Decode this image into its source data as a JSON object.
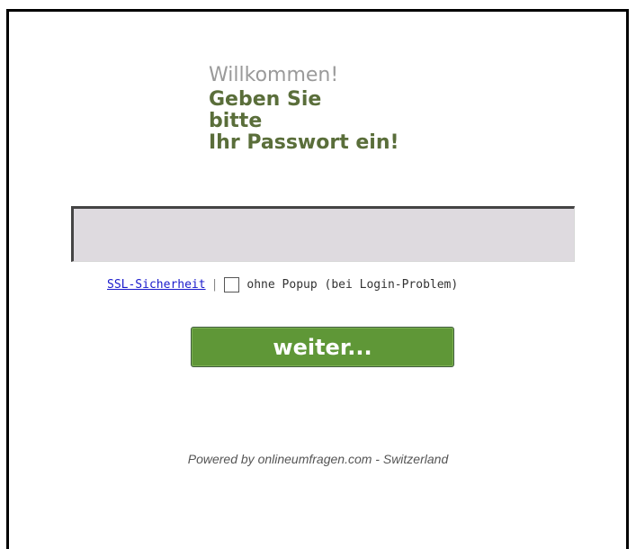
{
  "welcome": {
    "greeting": "Willkommen!",
    "prompt_lines": [
      "Geben Sie",
      "bitte",
      "Ihr Passwort ein!"
    ]
  },
  "password": {
    "value": "",
    "placeholder": ""
  },
  "options": {
    "ssl_link": "SSL-Sicherheit",
    "separator": "|",
    "no_popup_label": "ohne Popup (bei Login-Problem)",
    "no_popup_checked": false
  },
  "actions": {
    "continue_label": "weiter..."
  },
  "footer": {
    "text": "Powered by onlineumfragen.com - Switzerland"
  },
  "colors": {
    "accent": "#5f9737",
    "heading": "#5a6e3a",
    "greeting": "#9a9a9a",
    "link": "#1a1acc",
    "input_bg": "#dedadf"
  }
}
